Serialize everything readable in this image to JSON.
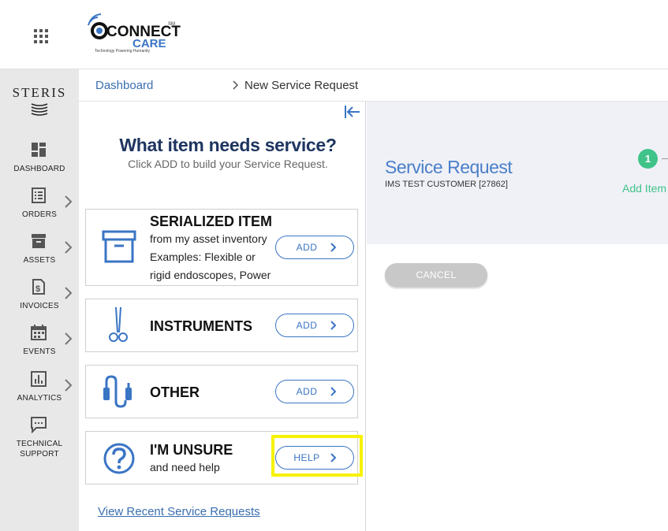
{
  "header": {
    "logo_main": "CONNECT",
    "logo_sub": "CARE",
    "logo_mark": "SM",
    "logo_tagline": "Technology Powering Humanity"
  },
  "rail": {
    "brand": "STERIS",
    "items": [
      {
        "label": "DASHBOARD",
        "icon": "dashboard-icon",
        "has_chevron": false
      },
      {
        "label": "ORDERS",
        "icon": "orders-icon",
        "has_chevron": true
      },
      {
        "label": "ASSETS",
        "icon": "assets-icon",
        "has_chevron": true
      },
      {
        "label": "INVOICES",
        "icon": "invoices-icon",
        "has_chevron": true
      },
      {
        "label": "EVENTS",
        "icon": "calendar-icon",
        "has_chevron": true
      },
      {
        "label": "ANALYTICS",
        "icon": "analytics-icon",
        "has_chevron": true
      },
      {
        "label_line1": "TECHNICAL",
        "label_line2": "SUPPORT",
        "icon": "chat-icon",
        "has_chevron": false
      }
    ]
  },
  "breadcrumb": {
    "link": "Dashboard",
    "current": "New Service Request"
  },
  "panel": {
    "title": "What item needs service?",
    "subtitle": "Click ADD to build your Service Request.",
    "cards": [
      {
        "title": "SERIALIZED ITEM",
        "line1": "from my asset inventory",
        "line2": "Examples: Flexible or",
        "line3": "rigid endoscopes, Power",
        "button": "ADD",
        "icon": "archive-box-icon"
      },
      {
        "title": "INSTRUMENTS",
        "button": "ADD",
        "icon": "surgical-clamp-icon"
      },
      {
        "title": "OTHER",
        "button": "ADD",
        "icon": "cable-icon"
      },
      {
        "title": "I'M UNSURE",
        "line1": "and need help",
        "button": "HELP",
        "icon": "question-icon"
      }
    ],
    "recent_link": "View Recent Service Requests"
  },
  "content": {
    "title": "Service Request",
    "customer": "IMS TEST CUSTOMER [27862]",
    "step_number": "1",
    "step_label": "Add Item",
    "cancel_label": "CANCEL"
  },
  "colors": {
    "accent_blue": "#3a75c4",
    "title_navy": "#1e3560",
    "step_green": "#3fc389",
    "highlight_yellow": "#f6f200"
  }
}
